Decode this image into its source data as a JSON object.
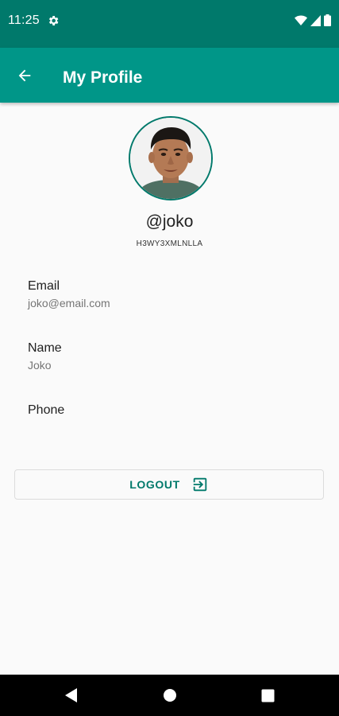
{
  "status_bar": {
    "time": "11:25",
    "icons": [
      "settings-gear-icon",
      "wifi-icon",
      "signal-icon",
      "battery-icon"
    ]
  },
  "app_bar": {
    "title": "My Profile",
    "back_icon": "arrow-back-icon"
  },
  "profile": {
    "username": "@joko",
    "user_id": "H3WY3XMLNLLA",
    "avatar": "user-avatar-photo"
  },
  "fields": [
    {
      "label": "Email",
      "value": "joko@email.com"
    },
    {
      "label": "Name",
      "value": "Joko"
    },
    {
      "label": "Phone",
      "value": ""
    }
  ],
  "logout": {
    "label": "LOGOUT",
    "icon": "exit-to-app-icon"
  },
  "nav_bar": {
    "icons": [
      "nav-back-icon",
      "nav-home-icon",
      "nav-recents-icon"
    ]
  },
  "colors": {
    "status_bar": "#00796b",
    "app_bar": "#009688",
    "accent": "#00796b",
    "background": "#fafafa"
  }
}
